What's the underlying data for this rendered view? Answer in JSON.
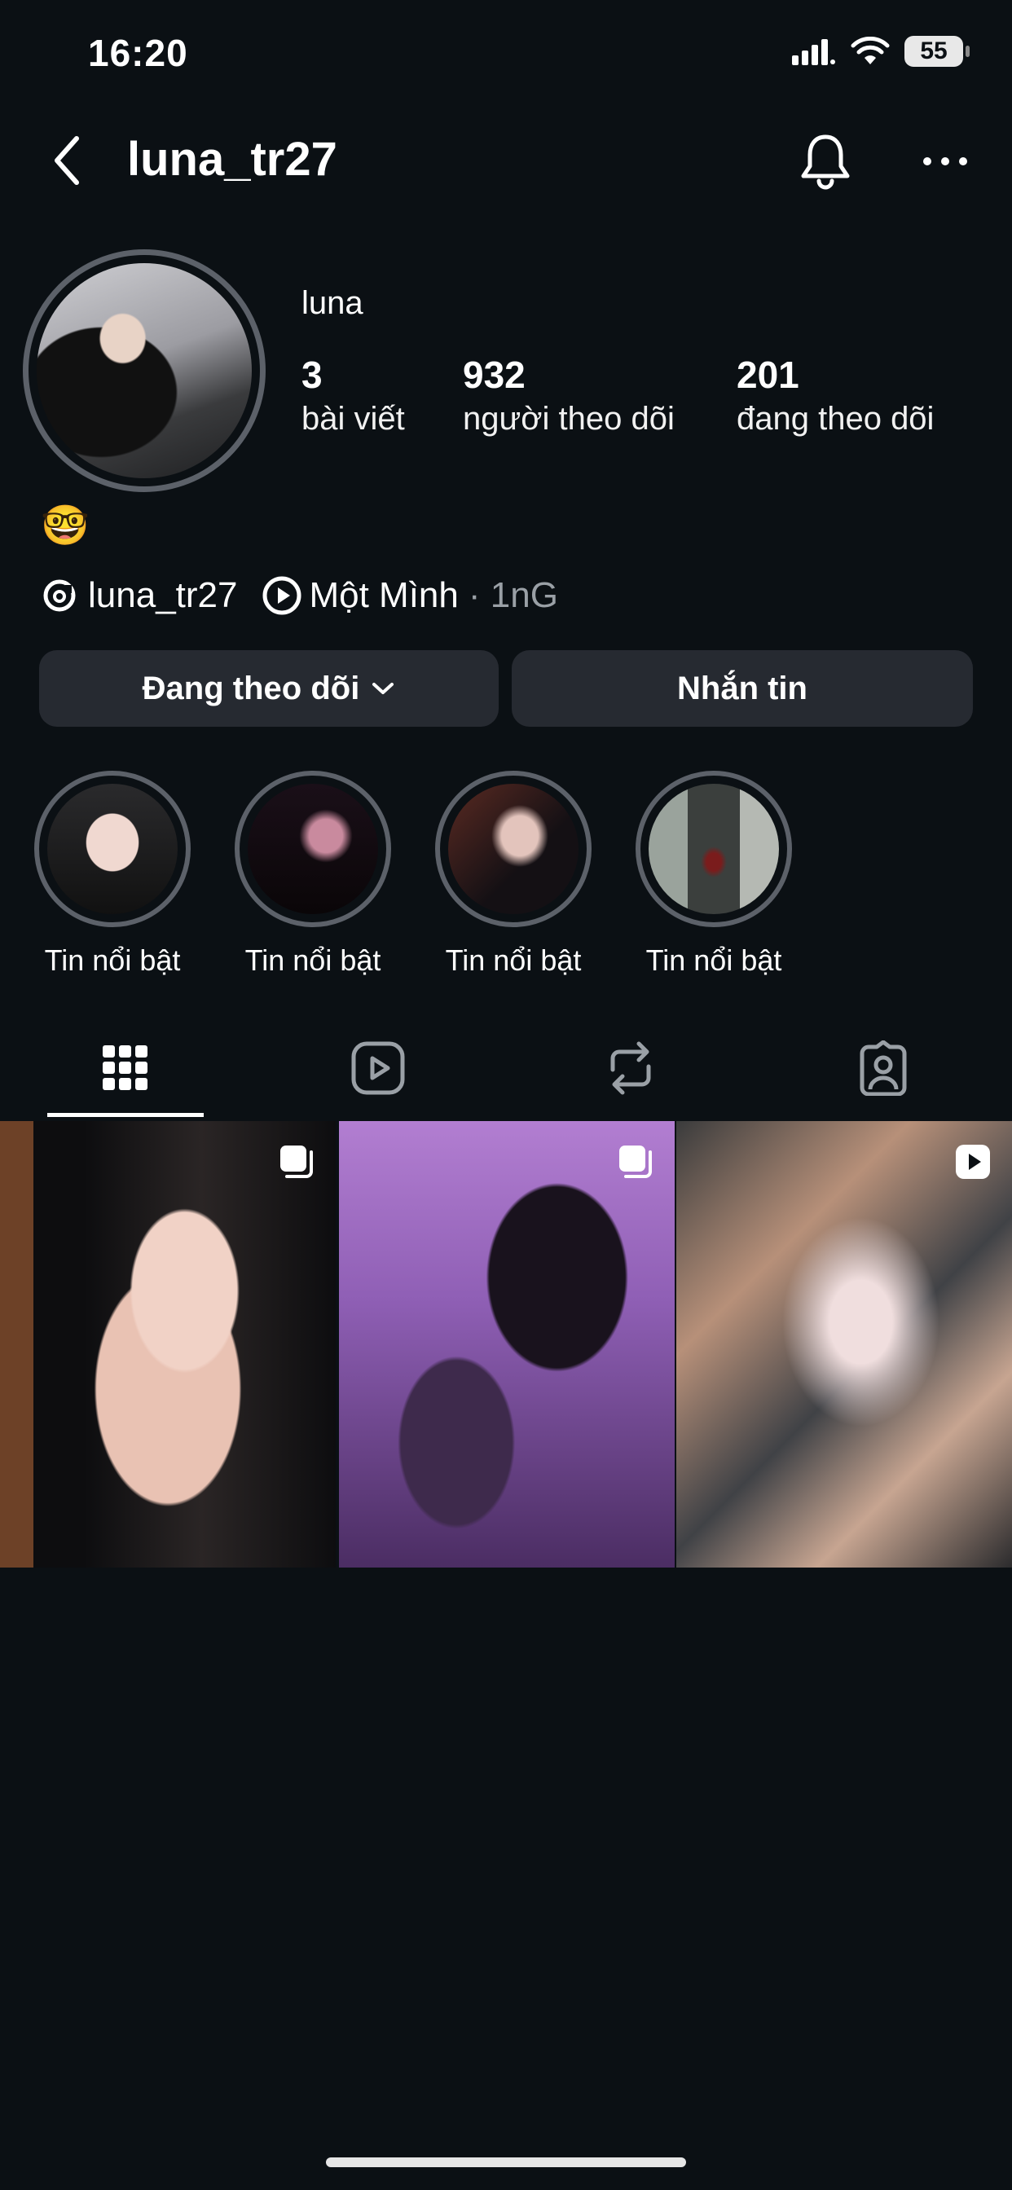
{
  "status_bar": {
    "time": "16:20",
    "battery": "55"
  },
  "header": {
    "username": "luna_tr27"
  },
  "profile": {
    "display_name": "luna",
    "stats": [
      {
        "value": "3",
        "label": "bài viết"
      },
      {
        "value": "932",
        "label": "người theo dõi"
      },
      {
        "value": "201",
        "label": "đang theo dõi"
      }
    ],
    "bio_emoji": "🤓",
    "threads_handle": "luna_tr27",
    "music_title": "Một Mình",
    "music_meta": "· 1nG"
  },
  "actions": {
    "following_label": "Đang theo dõi",
    "message_label": "Nhắn tin"
  },
  "highlights": [
    {
      "label": "Tin nổi bật"
    },
    {
      "label": "Tin nổi bật"
    },
    {
      "label": "Tin nổi bật"
    },
    {
      "label": "Tin nổi bật"
    }
  ],
  "tabs": [
    {
      "icon": "grid-icon",
      "active": true
    },
    {
      "icon": "reels-icon",
      "active": false
    },
    {
      "icon": "reposts-icon",
      "active": false
    },
    {
      "icon": "tagged-icon",
      "active": false
    }
  ],
  "posts": [
    {
      "type": "carousel"
    },
    {
      "type": "carousel"
    },
    {
      "type": "reel"
    }
  ]
}
